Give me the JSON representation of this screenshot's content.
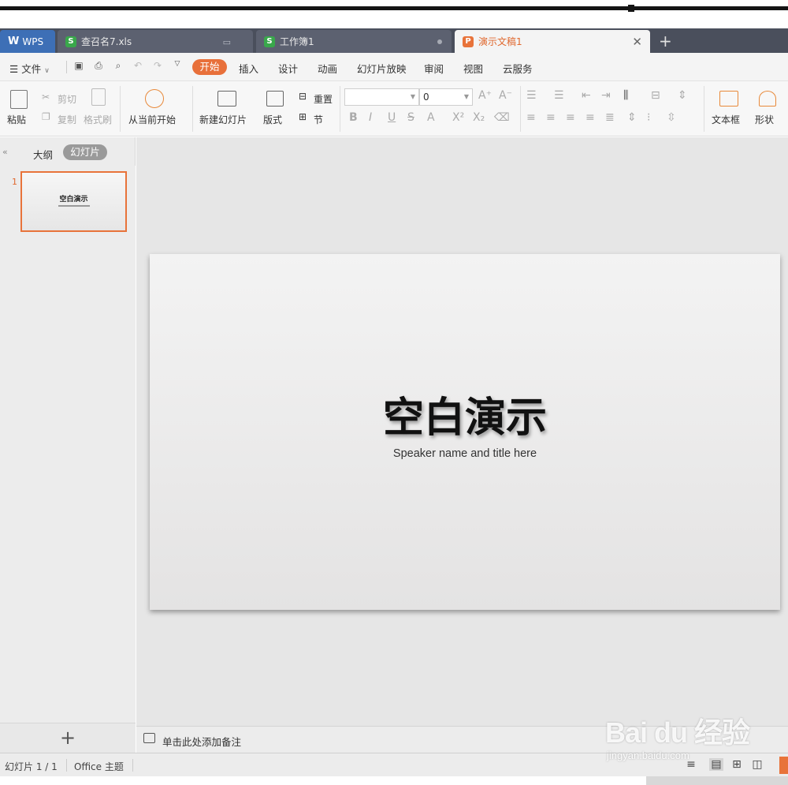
{
  "tabs": {
    "wps": "WPS",
    "xls1": "查召名7.xls",
    "xls2": "工作簿1",
    "ppt": "演示文稿1",
    "add": "+"
  },
  "menu": {
    "file": "文件",
    "active": "开始",
    "items": [
      "插入",
      "设计",
      "动画",
      "幻灯片放映",
      "审阅",
      "视图",
      "云服务"
    ]
  },
  "ribbon": {
    "paste": "粘贴",
    "cut": "剪切",
    "copy": "复制",
    "format_painter": "格式刷",
    "play_from_current": "从当前开始",
    "new_slide": "新建幻灯片",
    "layout": "版式",
    "reset": "重置",
    "section": "节",
    "font_size": "0",
    "textbox": "文本框",
    "shapes": "形状"
  },
  "leftpanel": {
    "outline_tab": "大纲",
    "slides_tab": "幻灯片",
    "slide_number": "1",
    "thumb_title": "空白演示",
    "add_button": "+"
  },
  "slide": {
    "title": "空白演示",
    "subtitle": "Speaker name and title here"
  },
  "notes": {
    "placeholder": "单击此处添加备注"
  },
  "status": {
    "slide_count": "幻灯片 1 / 1",
    "theme": "Office 主题"
  },
  "watermark": {
    "brand": "Bai du 经验",
    "url": "jingyan.baidu.com"
  },
  "colors": {
    "accent": "#e8703a",
    "wps_blue": "#3d6fb6",
    "tab_bar": "#4a4f5c"
  }
}
